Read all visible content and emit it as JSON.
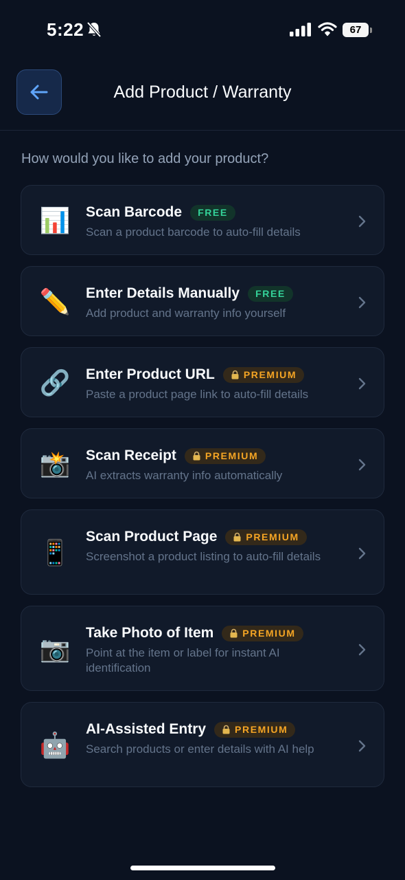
{
  "status_bar": {
    "time": "5:22",
    "battery": "67"
  },
  "header": {
    "title": "Add Product / Warranty",
    "back_icon": "arrow-left-icon"
  },
  "prompt": "How would you like to add your product?",
  "colors": {
    "background": "#0b1220",
    "card": "#111a2a",
    "free_badge": "#34d399",
    "premium_badge": "#f5a524",
    "accent": "#60a5fa"
  },
  "options": [
    {
      "emoji": "📊",
      "icon": "bar-chart-icon",
      "title": "Scan Barcode",
      "badge": "FREE",
      "badge_type": "free",
      "description": "Scan a product barcode to auto-fill details"
    },
    {
      "emoji": "✏️",
      "icon": "pencil-icon",
      "title": "Enter Details Manually",
      "badge": "FREE",
      "badge_type": "free",
      "description": "Add product and warranty info yourself"
    },
    {
      "emoji": "🔗",
      "icon": "link-icon",
      "title": "Enter Product URL",
      "badge": "PREMIUM",
      "badge_type": "premium",
      "description": "Paste a product page link to auto-fill details"
    },
    {
      "emoji": "📸",
      "icon": "camera-flash-icon",
      "title": "Scan Receipt",
      "badge": "PREMIUM",
      "badge_type": "premium",
      "description": "AI extracts warranty info automatically"
    },
    {
      "emoji": "📱",
      "icon": "mobile-phone-icon",
      "title": "Scan Product Page",
      "badge": "PREMIUM",
      "badge_type": "premium",
      "description": "Screenshot a product listing to auto-fill details"
    },
    {
      "emoji": "📷",
      "icon": "camera-icon",
      "title": "Take Photo of Item",
      "badge": "PREMIUM",
      "badge_type": "premium",
      "description": "Point at the item or label for instant AI identification"
    },
    {
      "emoji": "🤖",
      "icon": "robot-icon",
      "title": "AI-Assisted Entry",
      "badge": "PREMIUM",
      "badge_type": "premium",
      "description": "Search products or enter details with AI help"
    }
  ]
}
